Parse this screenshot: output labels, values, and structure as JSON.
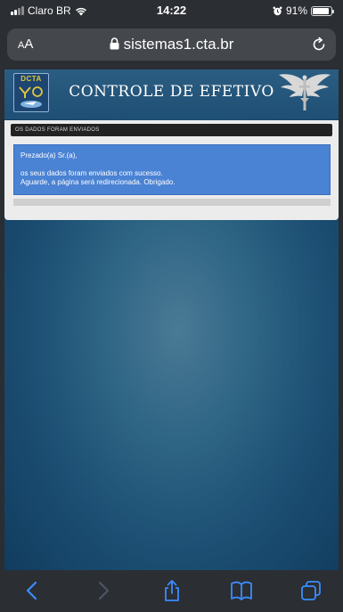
{
  "status_bar": {
    "carrier": "Claro BR",
    "time": "14:22",
    "battery_percent": "91%",
    "battery_level": 0.91
  },
  "browser": {
    "text_size_label_small": "A",
    "text_size_label_large": "A",
    "url": "sistemas1.cta.br"
  },
  "header": {
    "logo_text": "DCTA",
    "title": "CONTROLE DE EFETIVO"
  },
  "message": {
    "title": "OS DADOS FORAM ENVIADOS",
    "greeting": "Prezado(a) Sr.(a),",
    "line1": "os seus dados foram enviados com sucesso.",
    "line2": "Aguarde, a página será redirecionada. Obrigado."
  },
  "toolbar": {
    "icons": [
      "back-icon",
      "forward-icon",
      "share-icon",
      "bookmarks-icon",
      "tabs-icon"
    ]
  },
  "colors": {
    "accent_blue": "#4a82d4",
    "ios_blue": "#3b8cff",
    "page_bg_center": "#4a7a95",
    "page_bg_edge": "#0f3a5d"
  }
}
